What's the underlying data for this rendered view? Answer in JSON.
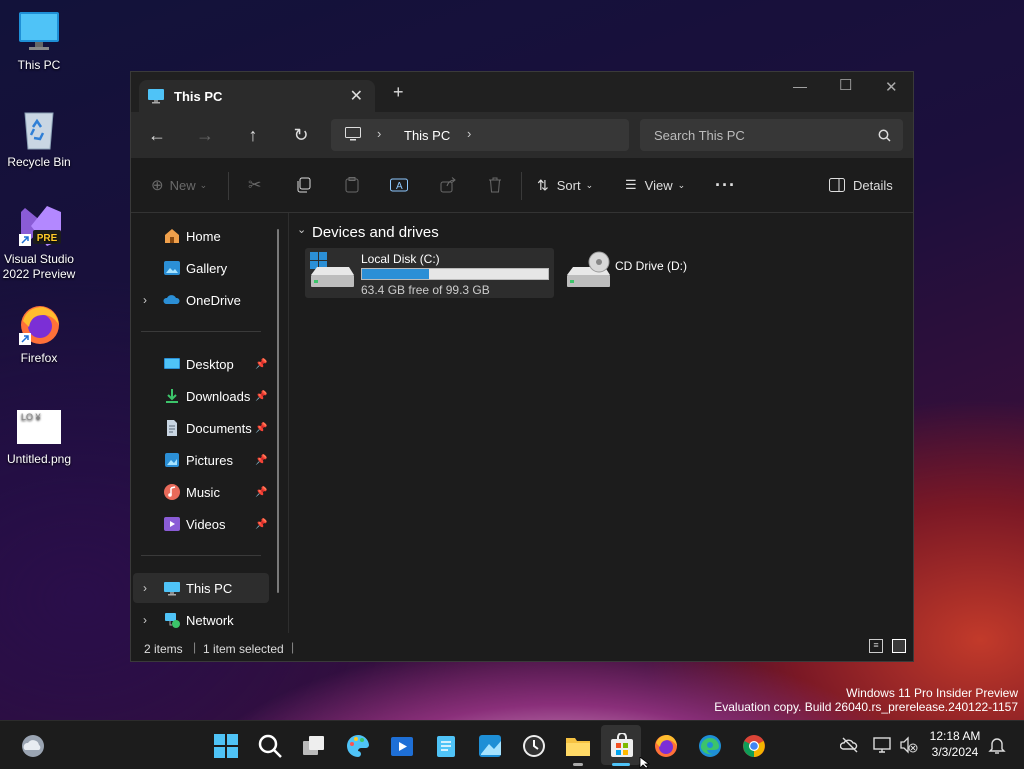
{
  "desktop": {
    "icons": [
      {
        "label": "This PC"
      },
      {
        "label": "Recycle Bin"
      },
      {
        "label": "Visual Studio 2022 Preview",
        "badge": "PRE"
      },
      {
        "label": "Firefox"
      },
      {
        "label": "Untitled.png",
        "thumb_text": "LO ¥"
      }
    ]
  },
  "window": {
    "tab_title": "This PC",
    "breadcrumb": "This PC",
    "search_placeholder": "Search This PC",
    "toolbar": {
      "new_label": "New",
      "sort_label": "Sort",
      "view_label": "View",
      "details_label": "Details"
    },
    "nav": {
      "home": "Home",
      "gallery": "Gallery",
      "onedrive": "OneDrive",
      "desktop": "Desktop",
      "downloads": "Downloads",
      "documents": "Documents",
      "pictures": "Pictures",
      "music": "Music",
      "videos": "Videos",
      "thispc": "This PC",
      "network": "Network"
    },
    "section_title": "Devices and drives",
    "drives": [
      {
        "name": "Local Disk (C:)",
        "free_text": "63.4 GB free of 99.3 GB",
        "used_fraction": 0.36
      },
      {
        "name": "CD Drive (D:)"
      }
    ],
    "status": {
      "items": "2 items",
      "selected": "1 item selected"
    }
  },
  "watermark": {
    "line1": "Windows 11 Pro Insider Preview",
    "line2": "Evaluation copy. Build 26040.rs_prerelease.240122-1157"
  },
  "clock": {
    "time": "12:18 AM",
    "date": "3/3/2024"
  },
  "colors": {
    "accent": "#2b8fd6",
    "window_bg": "#1c1c1c",
    "selected_nav": "#2d2d2d"
  }
}
